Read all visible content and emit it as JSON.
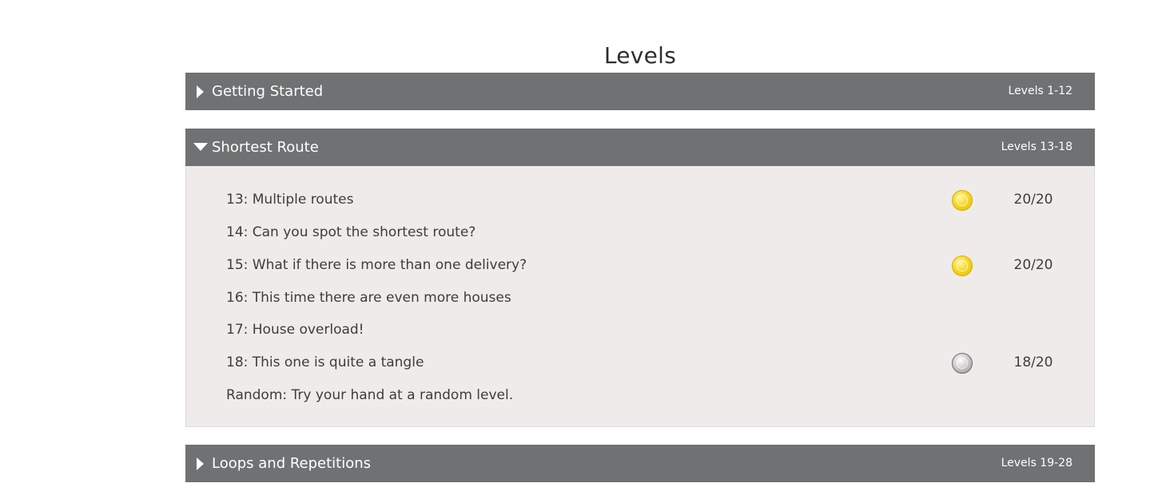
{
  "page": {
    "title": "Levels"
  },
  "sections": [
    {
      "title": "Getting Started",
      "range": "Levels 1-12",
      "expanded": false
    },
    {
      "title": "Shortest Route",
      "range": "Levels 13-18",
      "expanded": true,
      "levels": [
        {
          "name": "13: Multiple routes",
          "medal": "gold",
          "score": "20/20"
        },
        {
          "name": "14: Can you spot the shortest route?",
          "medal": "",
          "score": ""
        },
        {
          "name": "15: What if there is more than one delivery?",
          "medal": "gold",
          "score": "20/20"
        },
        {
          "name": "16: This time there are even more houses",
          "medal": "",
          "score": ""
        },
        {
          "name": "17: House overload!",
          "medal": "",
          "score": ""
        },
        {
          "name": "18: This one is quite a tangle",
          "medal": "silver",
          "score": "18/20"
        },
        {
          "name": "Random: Try your hand at a random level.",
          "medal": "",
          "score": ""
        }
      ]
    },
    {
      "title": "Loops and Repetitions",
      "range": "Levels 19-28",
      "expanded": false
    }
  ],
  "icons": {
    "collapsed": "caret-right-icon",
    "expanded": "caret-down-icon",
    "gold_medal": "gold-medal-icon",
    "silver_medal": "silver-medal-icon"
  },
  "colors": {
    "header_bg": "#6f7172",
    "body_bg": "#efebea",
    "gold": "#f6d92a",
    "silver": "#c8c8c8"
  }
}
